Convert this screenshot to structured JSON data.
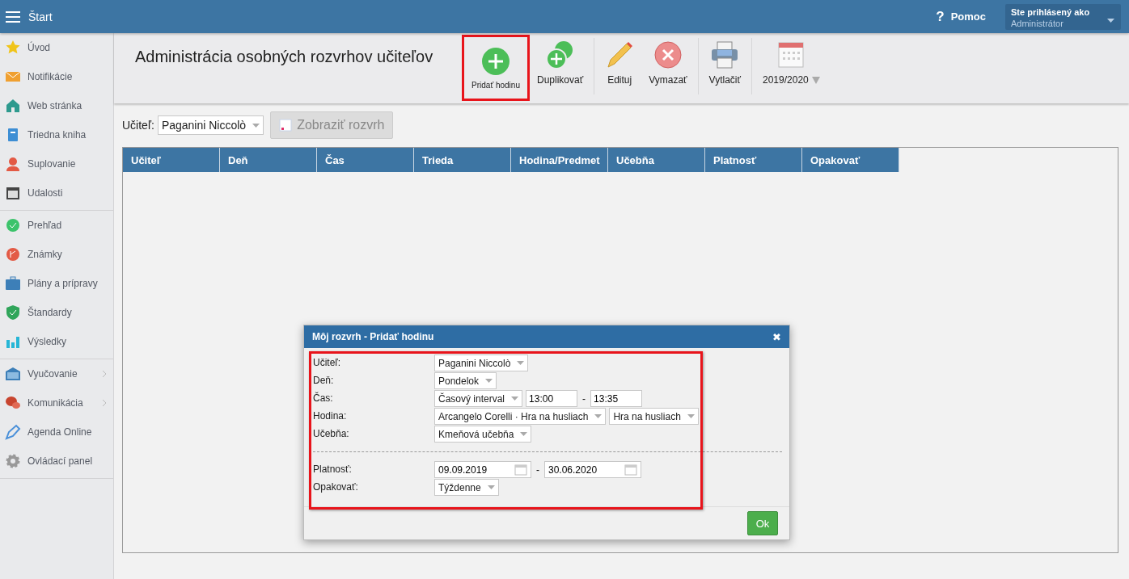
{
  "header": {
    "menu_title": "Štart",
    "help_icon": "?",
    "help": "Pomoc",
    "user_caption": "Ste prihlásený ako",
    "user_name": "Administrátor"
  },
  "sidebar": {
    "groups": [
      [
        {
          "label": "Úvod",
          "submenu": false
        },
        {
          "label": "Notifikácie",
          "submenu": false
        },
        {
          "label": "Web stránka",
          "submenu": false
        },
        {
          "label": "Triedna kniha",
          "submenu": false
        },
        {
          "label": "Suplovanie",
          "submenu": false
        },
        {
          "label": "Udalosti",
          "submenu": false
        }
      ],
      [
        {
          "label": "Prehľad",
          "submenu": false
        },
        {
          "label": "Známky",
          "submenu": false
        },
        {
          "label": "Plány a prípravy",
          "submenu": false
        },
        {
          "label": "Štandardy",
          "submenu": false
        },
        {
          "label": "Výsledky",
          "submenu": false
        }
      ],
      [
        {
          "label": "Vyučovanie",
          "submenu": true
        },
        {
          "label": "Komunikácia",
          "submenu": true
        },
        {
          "label": "Agenda Online",
          "submenu": false
        },
        {
          "label": "Ovládací panel",
          "submenu": false
        }
      ]
    ]
  },
  "toolbar": {
    "title": "Administrácia osobných rozvrhov učiteľov",
    "groups": [
      [
        {
          "label": "Pridať hodinu",
          "highlighted": true,
          "kind": "button"
        },
        {
          "label": "Duplikovať",
          "highlighted": false,
          "kind": "button"
        }
      ],
      [
        {
          "label": "Edituj",
          "highlighted": false,
          "kind": "button"
        },
        {
          "label": "Vymazať",
          "highlighted": false,
          "kind": "button"
        }
      ],
      [
        {
          "label": "Vytlačiť",
          "highlighted": false,
          "kind": "button"
        }
      ],
      [
        {
          "label": "2019/2020",
          "highlighted": false,
          "kind": "dropdown"
        }
      ]
    ]
  },
  "filter": {
    "label": "Učiteľ:",
    "teacher": "Paganini Niccolò",
    "show_button": {
      "label": "Zobraziť rozvrh",
      "disabled": true
    }
  },
  "table": {
    "columns": [
      "Učiteľ",
      "Deň",
      "Čas",
      "Trieda",
      "Hodina/Predmet",
      "Učebňa",
      "Platnosť",
      "Opakovať"
    ]
  },
  "dialog": {
    "title": "Môj rozvrh - Pridať hodinu",
    "close": "✖",
    "form_highlighted": true,
    "sections": [
      [
        {
          "label": "Učiteľ:",
          "controls": [
            {
              "kind": "select",
              "value": "Paganini Niccolò"
            }
          ]
        },
        {
          "label": "Deň:",
          "controls": [
            {
              "kind": "select",
              "value": "Pondelok"
            }
          ]
        },
        {
          "label": "Čas:",
          "controls": [
            {
              "kind": "select",
              "value": "Časový interval"
            },
            {
              "kind": "input",
              "value": "13:00"
            },
            {
              "kind": "dash",
              "value": "-"
            },
            {
              "kind": "input",
              "value": "13:35"
            }
          ]
        },
        {
          "label": "Hodina:",
          "controls": [
            {
              "kind": "select",
              "value": "Arcangelo Corelli · Hra na husliach"
            },
            {
              "kind": "select",
              "value": "Hra na husliach"
            }
          ]
        },
        {
          "label": "Učebňa:",
          "controls": [
            {
              "kind": "select",
              "value": "Kmeňová učebňa"
            }
          ]
        }
      ],
      [
        {
          "label": "Platnosť:",
          "controls": [
            {
              "kind": "date",
              "value": "09.09.2019"
            },
            {
              "kind": "dash",
              "value": "-"
            },
            {
              "kind": "date",
              "value": "30.06.2020"
            }
          ]
        },
        {
          "label": "Opakovať:",
          "controls": [
            {
              "kind": "select",
              "value": "Týždenne"
            }
          ]
        }
      ]
    ],
    "ok": "Ok"
  }
}
